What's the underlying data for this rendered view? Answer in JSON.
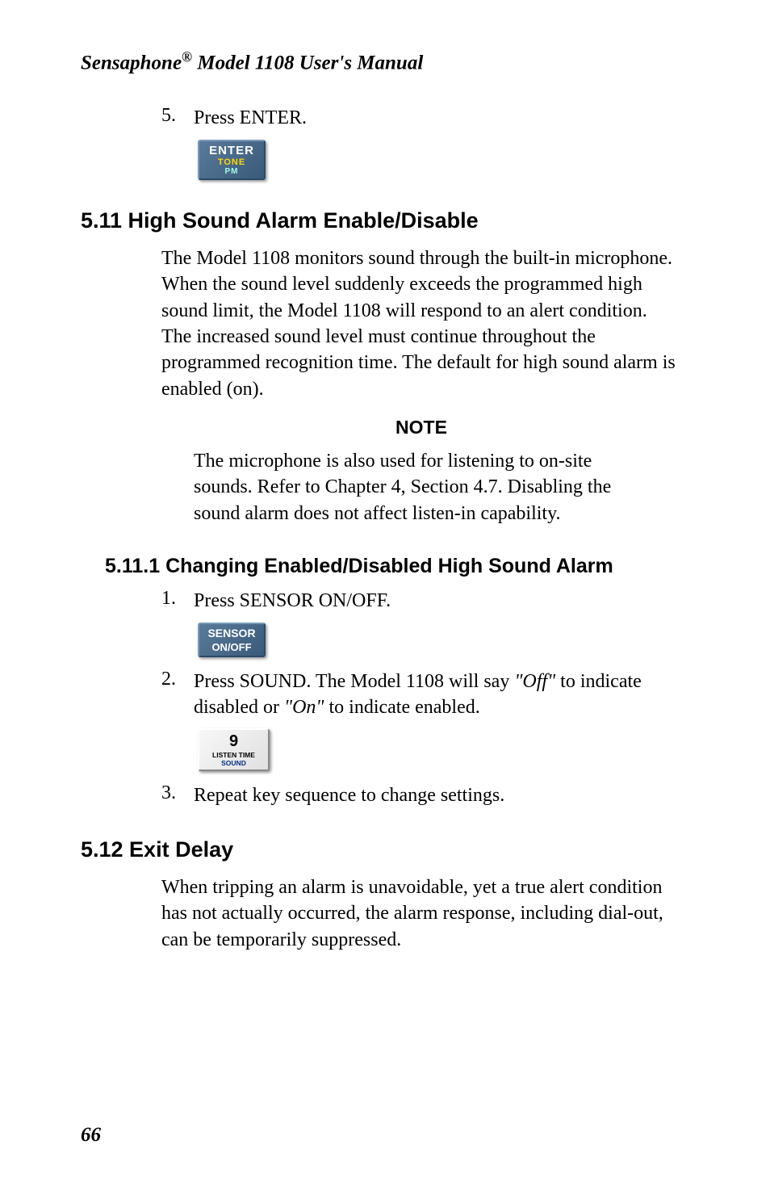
{
  "header": {
    "text": "Sensaphone® Model 1108 User's Manual"
  },
  "content": {
    "step5": {
      "number": "5.",
      "text": "Press ENTER."
    },
    "button_enter": {
      "line1": "ENTER",
      "line2": "TONE",
      "line3": "PM"
    },
    "section_5_11": {
      "heading": "5.11 High Sound Alarm Enable/Disable",
      "body": "The Model 1108 monitors sound through the built-in microphone. When the sound level suddenly exceeds the programmed high sound limit, the Model 1108 will respond to an alert condition. The increased sound level must continue throughout the programmed recognition time. The default for high sound alarm is enabled (on)."
    },
    "note": {
      "heading": "NOTE",
      "body": "The microphone is also used for listening to on-site sounds. Refer to Chapter 4, Section 4.7. Disabling the sound alarm does not affect listen-in capability."
    },
    "section_5_11_1": {
      "heading": "5.11.1 Changing Enabled/Disabled High Sound Alarm",
      "step1": {
        "number": "1.",
        "text": "Press SENSOR ON/OFF."
      },
      "button_sensor": {
        "line1": "SENSOR",
        "line2": "ON/OFF"
      },
      "step2": {
        "number": "2.",
        "text_pre": "Press SOUND. The Model 1108 will say ",
        "off": "\"Off\"",
        "text_mid": " to indicate disabled or ",
        "on": "\"On\"",
        "text_post": " to indicate enabled."
      },
      "button_9": {
        "line1": "9",
        "line2": "LISTEN TIME",
        "line3": "SOUND"
      },
      "step3": {
        "number": "3.",
        "text": "Repeat key sequence to change settings."
      }
    },
    "section_5_12": {
      "heading": "5.12  Exit Delay",
      "body": "When tripping an alarm is unavoidable, yet a true alert condition has not actually occurred, the alarm response, including dial-out, can be temporarily suppressed."
    }
  },
  "page_number": "66"
}
